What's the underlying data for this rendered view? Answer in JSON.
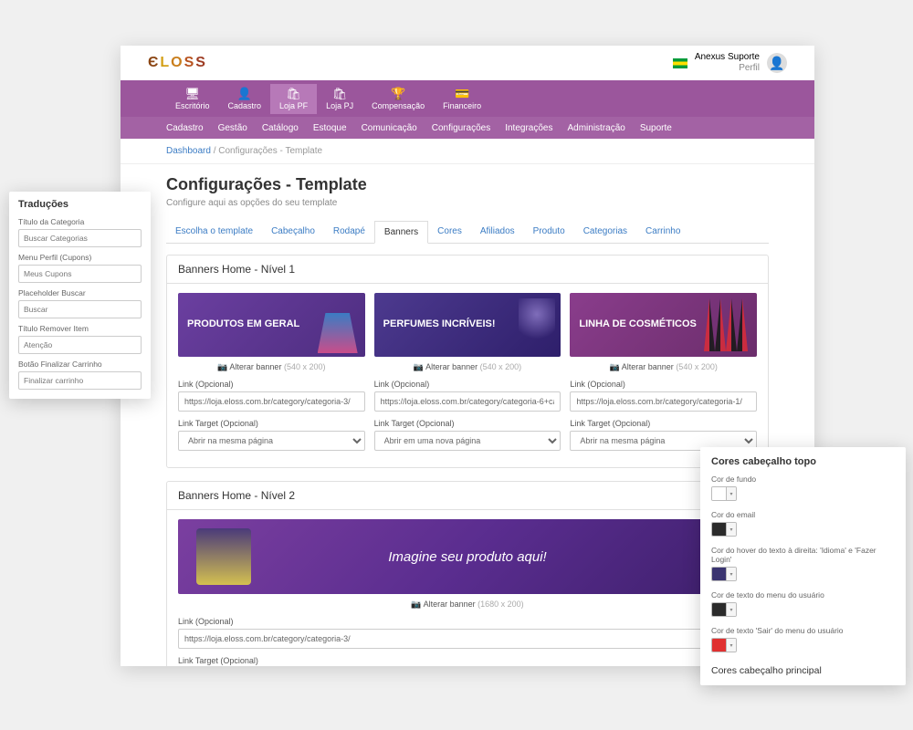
{
  "header": {
    "logo_chars": [
      "Є",
      "L",
      "O",
      "S",
      "S"
    ],
    "user_name": "Anexus Suporte",
    "user_sub": "Perfil"
  },
  "nav": {
    "items": [
      {
        "icon": "🖥",
        "label": "Escritório"
      },
      {
        "icon": "👤",
        "label": "Cadastro"
      },
      {
        "icon": "🛍",
        "label": "Loja PF"
      },
      {
        "icon": "🛍",
        "label": "Loja PJ"
      },
      {
        "icon": "🏆",
        "label": "Compensação"
      },
      {
        "icon": "💳",
        "label": "Financeiro"
      }
    ],
    "active_index": 2
  },
  "subnav": {
    "items": [
      "Cadastro",
      "Gestão",
      "Catálogo",
      "Estoque",
      "Comunicação",
      "Configurações",
      "Integrações",
      "Administração",
      "Suporte"
    ]
  },
  "breadcrumb": {
    "root": "Dashboard",
    "current": "Configurações - Template"
  },
  "page": {
    "title": "Configurações - Template",
    "subtitle": "Configure aqui as opções do seu template"
  },
  "tabs": {
    "items": [
      "Escolha o template",
      "Cabeçalho",
      "Rodapé",
      "Banners",
      "Cores",
      "Afiliados",
      "Produto",
      "Categorias",
      "Carrinho"
    ],
    "active_index": 3
  },
  "section1": {
    "title": "Banners Home - Nível 1",
    "banners": [
      {
        "text": "PRODUTOS EM GERAL",
        "change": "Alterar banner",
        "dim": "(540 x 200)",
        "link_label": "Link (Opcional)",
        "link_value": "https://loja.eloss.com.br/category/categoria-3/",
        "target_label": "Link Target (Opcional)",
        "target_value": "Abrir na mesma página"
      },
      {
        "text": "PERFUMES INCRÍVEIS!",
        "change": "Alterar banner",
        "dim": "(540 x 200)",
        "link_label": "Link (Opcional)",
        "link_value": "https://loja.eloss.com.br/category/categoria-6+ca",
        "target_label": "Link Target (Opcional)",
        "target_value": "Abrir em uma nova página"
      },
      {
        "text": "LINHA DE COSMÉTICOS",
        "change": "Alterar banner",
        "dim": "(540 x 200)",
        "link_label": "Link (Opcional)",
        "link_value": "https://loja.eloss.com.br/category/categoria-1/",
        "target_label": "Link Target (Opcional)",
        "target_value": "Abrir na mesma página"
      }
    ]
  },
  "section2": {
    "title": "Banners Home - Nível 2",
    "banner_text": "Imagine seu produto aqui!",
    "change": "Alterar banner",
    "dim": "(1680 x 200)",
    "link_label": "Link (Opcional)",
    "link_value": "https://loja.eloss.com.br/category/categoria-3/",
    "target_label": "Link Target (Opcional)"
  },
  "float_traducoes": {
    "title": "Traduções",
    "fields": [
      {
        "label": "Título da Categoria",
        "value": "Buscar Categorias"
      },
      {
        "label": "Menu Perfil (Cupons)",
        "value": "Meus Cupons"
      },
      {
        "label": "Placeholder Buscar",
        "value": "Buscar"
      },
      {
        "label": "Título Remover Item",
        "value": "Atenção"
      },
      {
        "label": "Botão Finalizar Carrinho",
        "value": "Finalizar carrinho"
      }
    ]
  },
  "float_cores": {
    "title": "Cores cabeçalho topo",
    "fields": [
      {
        "label": "Cor de fundo",
        "color": "#ffffff"
      },
      {
        "label": "Cor do email",
        "color": "#2b2b2b"
      },
      {
        "label": "Cor do hover do texto à direita: 'Idioma' e 'Fazer Login'",
        "color": "#3a3470"
      },
      {
        "label": "Cor de texto do menu do usuário",
        "color": "#2b2b2b"
      },
      {
        "label": "Cor de texto 'Sair' do menu do usuário",
        "color": "#e03030"
      }
    ],
    "secondary_title": "Cores cabeçalho principal"
  }
}
